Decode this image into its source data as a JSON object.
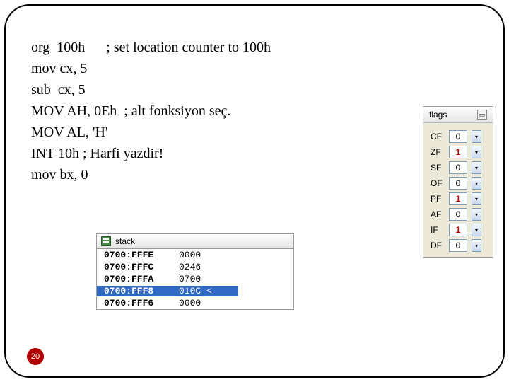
{
  "code": {
    "l1": "org  100h      ; set location counter to 100h",
    "l2": "mov cx, 5",
    "l3": "sub  cx, 5",
    "l4": "MOV AH, 0Eh  ; alt fonksiyon seç.",
    "l5": "MOV AL, 'H'",
    "l6": "INT 10h ; Harfi yazdir!",
    "l7": "mov bx, 0"
  },
  "stack": {
    "title": "stack",
    "rows": [
      {
        "addr": "0700:FFFE",
        "val": "0000",
        "sel": false,
        "mark": ""
      },
      {
        "addr": "0700:FFFC",
        "val": "0246",
        "sel": false,
        "mark": ""
      },
      {
        "addr": "0700:FFFA",
        "val": "0700",
        "sel": false,
        "mark": ""
      },
      {
        "addr": "0700:FFF8",
        "val": "010C",
        "sel": true,
        "mark": " <"
      },
      {
        "addr": "0700:FFF6",
        "val": "0000",
        "sel": false,
        "mark": ""
      }
    ]
  },
  "flags": {
    "title": "flags",
    "rows": [
      {
        "n": "CF",
        "v": "0",
        "hot": false
      },
      {
        "n": "ZF",
        "v": "1",
        "hot": true
      },
      {
        "n": "SF",
        "v": "0",
        "hot": false
      },
      {
        "n": "OF",
        "v": "0",
        "hot": false
      },
      {
        "n": "PF",
        "v": "1",
        "hot": true
      },
      {
        "n": "AF",
        "v": "0",
        "hot": false
      },
      {
        "n": "IF",
        "v": "1",
        "hot": true
      },
      {
        "n": "DF",
        "v": "0",
        "hot": false
      }
    ]
  },
  "page": "20"
}
